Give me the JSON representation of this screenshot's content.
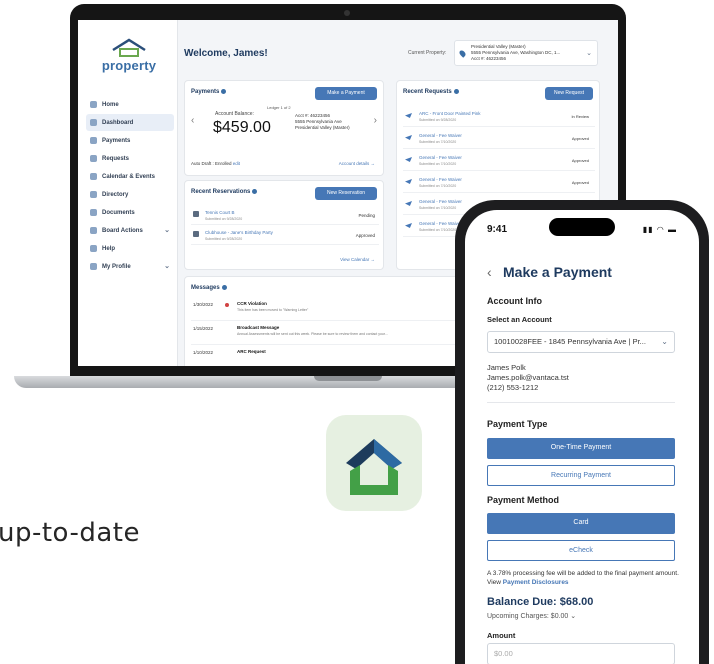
{
  "laptop": {
    "logo": "property",
    "nav": [
      {
        "label": "Home",
        "active": false,
        "chevron": false
      },
      {
        "label": "Dashboard",
        "active": true,
        "chevron": false
      },
      {
        "label": "Payments",
        "active": false,
        "chevron": false
      },
      {
        "label": "Requests",
        "active": false,
        "chevron": false
      },
      {
        "label": "Calendar & Events",
        "active": false,
        "chevron": false
      },
      {
        "label": "Directory",
        "active": false,
        "chevron": false
      },
      {
        "label": "Documents",
        "active": false,
        "chevron": false
      },
      {
        "label": "Board Actions",
        "active": false,
        "chevron": true
      },
      {
        "label": "Help",
        "active": false,
        "chevron": false
      },
      {
        "label": "My Profile",
        "active": false,
        "chevron": true
      }
    ],
    "welcome": "Welcome, James!",
    "current_property_label": "Current Property:",
    "property": {
      "name": "Presidential Valley (Master)",
      "address": "5555 Pennsylvania Ave, Washington DC, 1...",
      "acct": "Acct #: 46223456"
    },
    "payments": {
      "title": "Payments",
      "button": "Make a Payment",
      "ledger": "Ledger 1 of 2",
      "balance_label": "Account Balance:",
      "balance": "$459.00",
      "acct_number": "Acct #: 46223456",
      "acct_address": "5555 Pennsylvania Ave",
      "acct_property": "Presidential Valley (Master)",
      "autodraft": "Auto Draft : Enrolled",
      "autodraft_edit": "edit",
      "details_link": "Account details →"
    },
    "reservations": {
      "title": "Recent Reservations",
      "button": "New Reservation",
      "rows": [
        {
          "title": "Tennis Court B",
          "sub": "Submitted on 9/28/2020",
          "status": "Pending"
        },
        {
          "title": "Clubhouse - Jane's Birthday Party",
          "sub": "Submitted on 9/28/2020",
          "status": "Approved"
        }
      ],
      "view_link": "View Calendar →"
    },
    "requests": {
      "title": "Recent Requests",
      "button": "New Request",
      "rows": [
        {
          "title": "ARC - Front Door Painted Pink",
          "sub": "Submitted on 9/28/2020",
          "status": "In Review"
        },
        {
          "title": "General - Fee Waiver",
          "sub": "Submitted on 7/10/2020",
          "status": "Approved"
        },
        {
          "title": "General - Fee Waiver",
          "sub": "Submitted on 7/10/2020",
          "status": "Approved"
        },
        {
          "title": "General - Fee Waiver",
          "sub": "Submitted on 7/10/2020",
          "status": "Approved"
        },
        {
          "title": "General - Fee Waiver",
          "sub": "Submitted on 7/10/2020",
          "status": "Approved"
        },
        {
          "title": "General - Fee Waiver",
          "sub": "Submitted on 7/10/2020",
          "status": ""
        }
      ]
    },
    "messages": {
      "title": "Messages",
      "rows": [
        {
          "date": "1/30/2022",
          "subject": "CCR Violation",
          "body": "This item has been moved to \"Warning Letter\"",
          "unread": true
        },
        {
          "date": "1/15/2022",
          "subject": "Broadcast Message",
          "body": "Annual Assessments will be sent out this week. Please be sure to review them and contact your...",
          "unread": false
        },
        {
          "date": "1/10/2022",
          "subject": "ARC Request",
          "body": "",
          "unread": false
        }
      ]
    }
  },
  "tagline": "up-to-date",
  "phone": {
    "time": "9:41",
    "status_icons": "▮▮ ◠ ▬",
    "header": "Make a Payment",
    "account_info": "Account Info",
    "select_account_label": "Select an Account",
    "selected_account": "10010028FEE - 1845 Pennsylvania Ave | Pr...",
    "name": "James Polk",
    "email": "James.polk@vantaca.tst",
    "phone": "(212) 553-1212",
    "payment_type": "Payment Type",
    "one_time": "One-Time Payment",
    "recurring": "Recurring Payment",
    "payment_method": "Payment Method",
    "card": "Card",
    "echeck": "eCheck",
    "fee_note": "A 3.78% processing fee will be added to the final payment amount. View",
    "fee_link": "Payment Disclosures",
    "balance_due": "Balance Due: $68.00",
    "upcoming": "Upcoming Charges: $0.00",
    "amount_label": "Amount",
    "amount_placeholder": "$0.00"
  },
  "colors": {
    "accent": "#4677b6",
    "brand_navy": "#1e3a5f",
    "icon_bg": "#e6f0e1",
    "icon_green": "#43a047"
  }
}
